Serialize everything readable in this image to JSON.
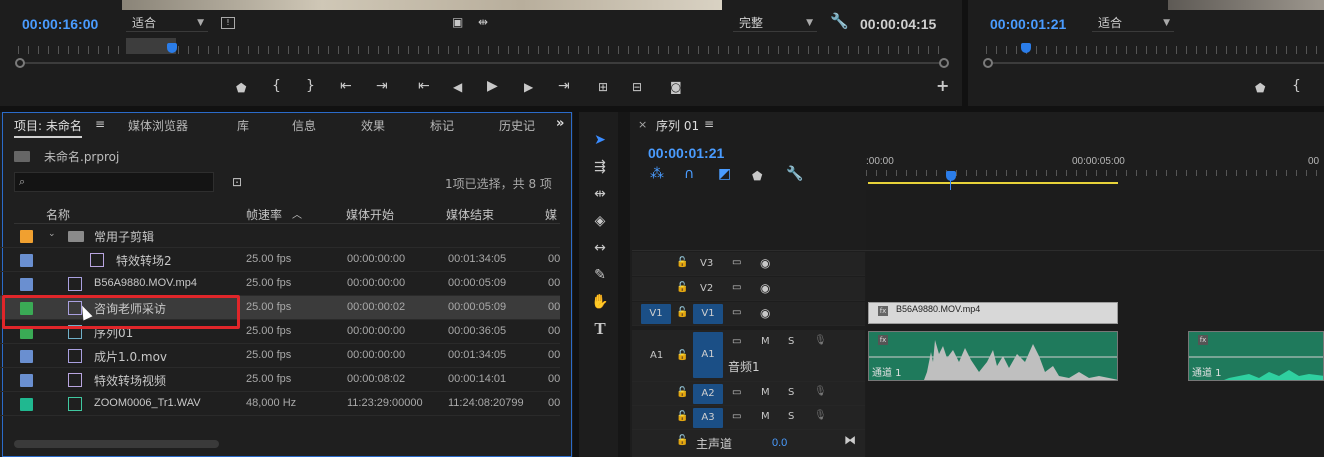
{
  "source_monitor": {
    "timecode": "00:00:16:00",
    "zoom": "适合",
    "quality": "完整",
    "duration": "00:00:04:15"
  },
  "program_monitor": {
    "timecode": "00:00:01:21",
    "zoom": "适合"
  },
  "project_panel": {
    "tabs": [
      "项目: 未命名",
      "媒体浏览器",
      "库",
      "信息",
      "效果",
      "标记",
      "历史记"
    ],
    "project_file": "未命名.prproj",
    "selection_status": "1项已选择，共 8 项",
    "search_placeholder": "",
    "columns": [
      "名称",
      "帧速率",
      "媒体开始",
      "媒体结束",
      "媒"
    ],
    "items": [
      {
        "name": "常用子剪辑",
        "fps": "",
        "start": "",
        "end": "",
        "extra": "",
        "color": "#f0a030",
        "kind": "folder"
      },
      {
        "name": "特效转场2",
        "fps": "25.00 fps",
        "start": "00:00:00:00",
        "end": "00:01:34:05",
        "extra": "00",
        "color": "#6a8fd0",
        "kind": "sequence"
      },
      {
        "name": "B56A9880.MOV.mp4",
        "fps": "25.00 fps",
        "start": "00:00:00:00",
        "end": "00:00:05:09",
        "extra": "00",
        "color": "#6a8fd0",
        "kind": "clip"
      },
      {
        "name": "咨询老师采访",
        "fps": "25.00 fps",
        "start": "00:00:00:02",
        "end": "00:00:05:09",
        "extra": "00",
        "color": "#3aaa55",
        "kind": "clip"
      },
      {
        "name": "序列01",
        "fps": "25.00 fps",
        "start": "00:00:00:00",
        "end": "00:00:36:05",
        "extra": "00",
        "color": "#3aaa55",
        "kind": "sequence"
      },
      {
        "name": "成片1.0.mov",
        "fps": "25.00 fps",
        "start": "00:00:00:00",
        "end": "00:01:34:05",
        "extra": "00",
        "color": "#6a8fd0",
        "kind": "clip"
      },
      {
        "name": "特效转场视频",
        "fps": "25.00 fps",
        "start": "00:00:08:02",
        "end": "00:00:14:01",
        "extra": "00",
        "color": "#6a8fd0",
        "kind": "sequence"
      },
      {
        "name": "ZOOM0006_Tr1.WAV",
        "fps": "48,000 Hz",
        "start": "11:23:29:00000",
        "end": "11:24:08:20799",
        "extra": "00",
        "color": "#20b890",
        "kind": "audio"
      }
    ]
  },
  "timeline": {
    "sequence_name": "序列 01",
    "timecode": "00:00:01:21",
    "ruler_labels": [
      ":00:00",
      "00:00:05:00",
      "00"
    ],
    "video_tracks": [
      "V3",
      "V2",
      "V1"
    ],
    "audio_tracks": [
      "A1",
      "A2",
      "A3"
    ],
    "source_patch_video": "V1",
    "source_patch_audio": "A1",
    "master_label": "主声道",
    "master_value": "0.0",
    "track_audio_name": "音频1",
    "video_clip_name": "B56A9880.MOV.mp4",
    "audio_clip_label": "通道 1",
    "audio_clip_label_2": "通道 1",
    "btn_m": "M",
    "btn_s": "S"
  }
}
